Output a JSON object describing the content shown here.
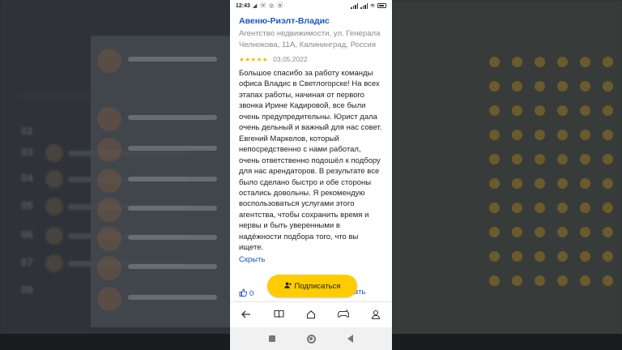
{
  "status_bar": {
    "time": "12:43",
    "icons": "◢ ⓦ ◎ ⦿",
    "wifi": "≋",
    "battery": ""
  },
  "review": {
    "org_name": "Авеню-Риэлт-Владис",
    "org_address": "Агентство недвижимости, ул. Генерала Челнокова, 11А, Калининград, Россия",
    "stars": "★★★★★",
    "rating": 5,
    "date": "03.05.2022",
    "text": "Большое спасибо за работу команды офиса Владис в Светлогорске! На всех этапах работы, начиная от первого звонка Ирине Кадировой, все были очень предупредительны. Юрист дала очень дельный и важный для нас совет. Евгений Маркелов, который непосредственно с нами работал, очень ответственно подошёл к подбору для нас арендаторов. В результате все было сделано быстро и обе стороны остались довольны. Я рекомендую воспользоваться услугами этого агентства, чтобы сохранить время и нервы и быть уверенными в надёжности подбора того, что вы ищете.",
    "collapse_label": "Скрыть",
    "likes": "0",
    "answer_label": "ать"
  },
  "subscribe": {
    "label": "Подписаться",
    "icon": "user-plus-icon"
  },
  "nav": {
    "back": "←",
    "book": "📖",
    "home": "⌂",
    "game": "🎮",
    "profile": "👤"
  },
  "colors": {
    "accent": "#ffcc00",
    "link": "#1a56c4",
    "star": "#f5b800"
  }
}
